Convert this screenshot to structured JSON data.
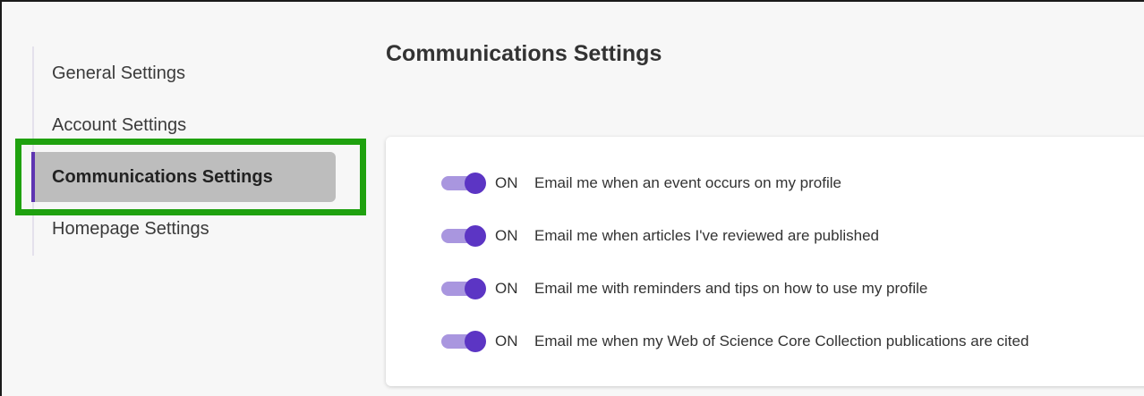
{
  "sidebar": {
    "items": [
      {
        "label": "General Settings"
      },
      {
        "label": "Account Settings"
      },
      {
        "label": "Communications Settings"
      },
      {
        "label": "Homepage Settings"
      }
    ],
    "active_index": 2
  },
  "page": {
    "title": "Communications Settings"
  },
  "settings": [
    {
      "state": "ON",
      "label": "Email me when an event occurs on my profile",
      "enabled": true
    },
    {
      "state": "ON",
      "label": "Email me when articles I've reviewed are published",
      "enabled": true
    },
    {
      "state": "ON",
      "label": "Email me with reminders and tips on how to use my profile",
      "enabled": true
    },
    {
      "state": "ON",
      "label": "Email me when my Web of Science Core Collection publications are cited",
      "enabled": true
    }
  ],
  "colors": {
    "toggle_knob": "#5c35c4",
    "toggle_track": "#a996df",
    "active_nav_bg": "#bdbdbd",
    "highlight_border": "#1fa10f"
  }
}
